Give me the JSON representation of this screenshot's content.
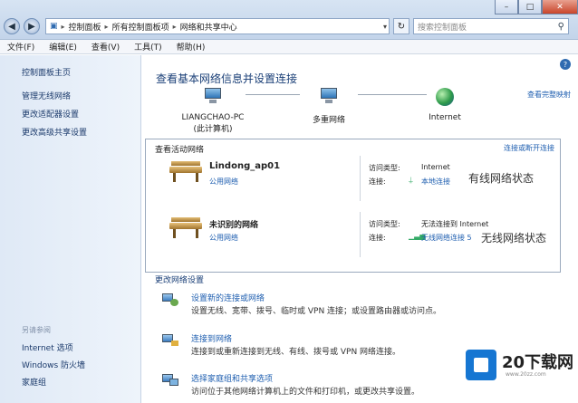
{
  "address": {
    "crumbs": [
      "控制面板",
      "所有控制面板项",
      "网络和共享中心"
    ],
    "search_placeholder": "搜索控制面板"
  },
  "menu": [
    "文件(F)",
    "编辑(E)",
    "查看(V)",
    "工具(T)",
    "帮助(H)"
  ],
  "sidebar": {
    "home": "控制面板主页",
    "links": [
      "管理无线网络",
      "更改适配器设置",
      "更改高级共享设置"
    ],
    "see_also_header": "另请参阅",
    "see_also": [
      "Internet 选项",
      "Windows 防火墙",
      "家庭组"
    ]
  },
  "main": {
    "title": "查看基本网络信息并设置连接",
    "full_map": "查看完整映射",
    "map": {
      "computer_name": "LIANGCHAO-PC",
      "computer_sub": "(此计算机)",
      "multi_network": "多重网络",
      "internet": "Internet"
    },
    "active": {
      "title": "查看活动网络",
      "disconnect": "连接或断开连接",
      "access_label": "访问类型:",
      "conn_label": "连接:",
      "networks": [
        {
          "name": "Lindong_ap01",
          "type": "公用网络",
          "access": "Internet",
          "conn": "本地连接",
          "annotation": "有线网络状态"
        },
        {
          "name": "未识别的网络",
          "type": "公用网络",
          "access": "无法连接到 Internet",
          "conn": "无线网络连接 5",
          "annotation": "无线网络状态"
        }
      ]
    },
    "change_header": "更改网络设置",
    "tasks": [
      {
        "title": "设置新的连接或网络",
        "desc": "设置无线、宽带、拨号、临时或 VPN 连接；或设置路由器或访问点。"
      },
      {
        "title": "连接到网络",
        "desc": "连接到或重新连接到无线、有线、拨号或 VPN 网络连接。"
      },
      {
        "title": "选择家庭组和共享选项",
        "desc": "访问位于其他网络计算机上的文件和打印机，或更改共享设置。"
      }
    ]
  },
  "watermark": {
    "brand": "20下载网",
    "url": "www.20zz.com"
  }
}
